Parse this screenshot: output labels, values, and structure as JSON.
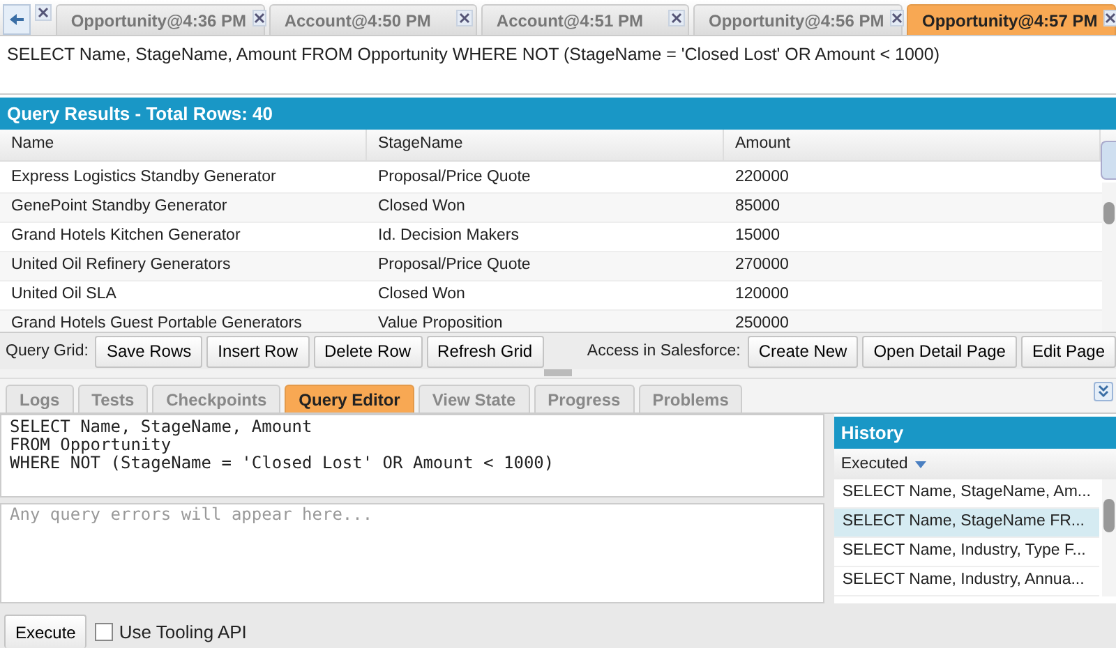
{
  "tabs": [
    {
      "label": "Opportunity@4:36 PM",
      "selected": false
    },
    {
      "label": "Account@4:50 PM",
      "selected": false
    },
    {
      "label": "Account@4:51 PM",
      "selected": false
    },
    {
      "label": "Opportunity@4:56 PM",
      "selected": false
    },
    {
      "label": "Opportunity@4:57 PM",
      "selected": true
    }
  ],
  "query_text": "SELECT Name, StageName, Amount FROM Opportunity WHERE NOT (StageName = 'Closed Lost' OR Amount < 1000)",
  "results": {
    "title": "Query Results - Total Rows: 40",
    "columns": [
      "Name",
      "StageName",
      "Amount"
    ],
    "rows": [
      [
        "Express Logistics Standby Generator",
        "Proposal/Price Quote",
        "220000"
      ],
      [
        "GenePoint Standby Generator",
        "Closed Won",
        "85000"
      ],
      [
        "Grand Hotels Kitchen Generator",
        "Id. Decision Makers",
        "15000"
      ],
      [
        "United Oil Refinery Generators",
        "Proposal/Price Quote",
        "270000"
      ],
      [
        "United Oil SLA",
        "Closed Won",
        "120000"
      ],
      [
        "Grand Hotels Guest Portable Generators",
        "Value Proposition",
        "250000"
      ]
    ]
  },
  "grid_toolbar": {
    "label": "Query Grid:",
    "buttons": [
      "Save Rows",
      "Insert Row",
      "Delete Row",
      "Refresh Grid"
    ],
    "access_label": "Access in Salesforce:",
    "access_buttons": [
      "Create New",
      "Open Detail Page",
      "Edit Page"
    ]
  },
  "panel_tabs": [
    {
      "label": "Logs",
      "selected": false
    },
    {
      "label": "Tests",
      "selected": false
    },
    {
      "label": "Checkpoints",
      "selected": false
    },
    {
      "label": "Query Editor",
      "selected": true
    },
    {
      "label": "View State",
      "selected": false
    },
    {
      "label": "Progress",
      "selected": false
    },
    {
      "label": "Problems",
      "selected": false
    }
  ],
  "editor": {
    "lines": [
      "SELECT Name, StageName, Amount",
      "FROM Opportunity",
      "WHERE NOT (StageName = 'Closed Lost' OR Amount < 1000)"
    ],
    "errors_placeholder": "Any query errors will appear here..."
  },
  "history": {
    "title": "History",
    "column": "Executed",
    "items": [
      {
        "text": "SELECT Name, StageName, Am...",
        "selected": false
      },
      {
        "text": "SELECT Name, StageName FR...",
        "selected": true
      },
      {
        "text": "SELECT Name, Industry, Type F...",
        "selected": false
      },
      {
        "text": "SELECT Name, Industry, Annua...",
        "selected": false
      }
    ]
  },
  "execute_button": "Execute",
  "tooling_api": {
    "label": "Use Tooling API",
    "checked": false
  }
}
